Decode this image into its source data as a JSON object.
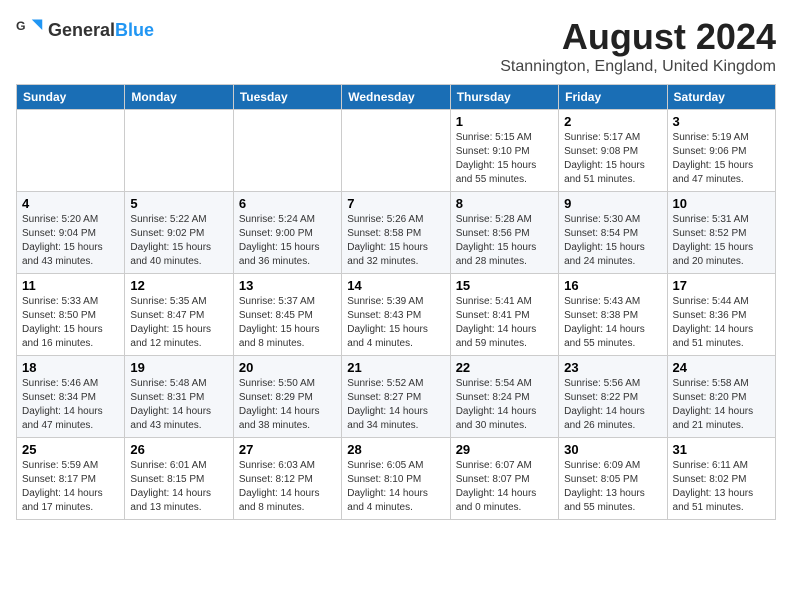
{
  "header": {
    "logo_general": "General",
    "logo_blue": "Blue",
    "title": "August 2024",
    "subtitle": "Stannington, England, United Kingdom"
  },
  "weekdays": [
    "Sunday",
    "Monday",
    "Tuesday",
    "Wednesday",
    "Thursday",
    "Friday",
    "Saturday"
  ],
  "weeks": [
    [
      {
        "day": "",
        "detail": ""
      },
      {
        "day": "",
        "detail": ""
      },
      {
        "day": "",
        "detail": ""
      },
      {
        "day": "",
        "detail": ""
      },
      {
        "day": "1",
        "detail": "Sunrise: 5:15 AM\nSunset: 9:10 PM\nDaylight: 15 hours\nand 55 minutes."
      },
      {
        "day": "2",
        "detail": "Sunrise: 5:17 AM\nSunset: 9:08 PM\nDaylight: 15 hours\nand 51 minutes."
      },
      {
        "day": "3",
        "detail": "Sunrise: 5:19 AM\nSunset: 9:06 PM\nDaylight: 15 hours\nand 47 minutes."
      }
    ],
    [
      {
        "day": "4",
        "detail": "Sunrise: 5:20 AM\nSunset: 9:04 PM\nDaylight: 15 hours\nand 43 minutes."
      },
      {
        "day": "5",
        "detail": "Sunrise: 5:22 AM\nSunset: 9:02 PM\nDaylight: 15 hours\nand 40 minutes."
      },
      {
        "day": "6",
        "detail": "Sunrise: 5:24 AM\nSunset: 9:00 PM\nDaylight: 15 hours\nand 36 minutes."
      },
      {
        "day": "7",
        "detail": "Sunrise: 5:26 AM\nSunset: 8:58 PM\nDaylight: 15 hours\nand 32 minutes."
      },
      {
        "day": "8",
        "detail": "Sunrise: 5:28 AM\nSunset: 8:56 PM\nDaylight: 15 hours\nand 28 minutes."
      },
      {
        "day": "9",
        "detail": "Sunrise: 5:30 AM\nSunset: 8:54 PM\nDaylight: 15 hours\nand 24 minutes."
      },
      {
        "day": "10",
        "detail": "Sunrise: 5:31 AM\nSunset: 8:52 PM\nDaylight: 15 hours\nand 20 minutes."
      }
    ],
    [
      {
        "day": "11",
        "detail": "Sunrise: 5:33 AM\nSunset: 8:50 PM\nDaylight: 15 hours\nand 16 minutes."
      },
      {
        "day": "12",
        "detail": "Sunrise: 5:35 AM\nSunset: 8:47 PM\nDaylight: 15 hours\nand 12 minutes."
      },
      {
        "day": "13",
        "detail": "Sunrise: 5:37 AM\nSunset: 8:45 PM\nDaylight: 15 hours\nand 8 minutes."
      },
      {
        "day": "14",
        "detail": "Sunrise: 5:39 AM\nSunset: 8:43 PM\nDaylight: 15 hours\nand 4 minutes."
      },
      {
        "day": "15",
        "detail": "Sunrise: 5:41 AM\nSunset: 8:41 PM\nDaylight: 14 hours\nand 59 minutes."
      },
      {
        "day": "16",
        "detail": "Sunrise: 5:43 AM\nSunset: 8:38 PM\nDaylight: 14 hours\nand 55 minutes."
      },
      {
        "day": "17",
        "detail": "Sunrise: 5:44 AM\nSunset: 8:36 PM\nDaylight: 14 hours\nand 51 minutes."
      }
    ],
    [
      {
        "day": "18",
        "detail": "Sunrise: 5:46 AM\nSunset: 8:34 PM\nDaylight: 14 hours\nand 47 minutes."
      },
      {
        "day": "19",
        "detail": "Sunrise: 5:48 AM\nSunset: 8:31 PM\nDaylight: 14 hours\nand 43 minutes."
      },
      {
        "day": "20",
        "detail": "Sunrise: 5:50 AM\nSunset: 8:29 PM\nDaylight: 14 hours\nand 38 minutes."
      },
      {
        "day": "21",
        "detail": "Sunrise: 5:52 AM\nSunset: 8:27 PM\nDaylight: 14 hours\nand 34 minutes."
      },
      {
        "day": "22",
        "detail": "Sunrise: 5:54 AM\nSunset: 8:24 PM\nDaylight: 14 hours\nand 30 minutes."
      },
      {
        "day": "23",
        "detail": "Sunrise: 5:56 AM\nSunset: 8:22 PM\nDaylight: 14 hours\nand 26 minutes."
      },
      {
        "day": "24",
        "detail": "Sunrise: 5:58 AM\nSunset: 8:20 PM\nDaylight: 14 hours\nand 21 minutes."
      }
    ],
    [
      {
        "day": "25",
        "detail": "Sunrise: 5:59 AM\nSunset: 8:17 PM\nDaylight: 14 hours\nand 17 minutes."
      },
      {
        "day": "26",
        "detail": "Sunrise: 6:01 AM\nSunset: 8:15 PM\nDaylight: 14 hours\nand 13 minutes."
      },
      {
        "day": "27",
        "detail": "Sunrise: 6:03 AM\nSunset: 8:12 PM\nDaylight: 14 hours\nand 8 minutes."
      },
      {
        "day": "28",
        "detail": "Sunrise: 6:05 AM\nSunset: 8:10 PM\nDaylight: 14 hours\nand 4 minutes."
      },
      {
        "day": "29",
        "detail": "Sunrise: 6:07 AM\nSunset: 8:07 PM\nDaylight: 14 hours\nand 0 minutes."
      },
      {
        "day": "30",
        "detail": "Sunrise: 6:09 AM\nSunset: 8:05 PM\nDaylight: 13 hours\nand 55 minutes."
      },
      {
        "day": "31",
        "detail": "Sunrise: 6:11 AM\nSunset: 8:02 PM\nDaylight: 13 hours\nand 51 minutes."
      }
    ]
  ]
}
